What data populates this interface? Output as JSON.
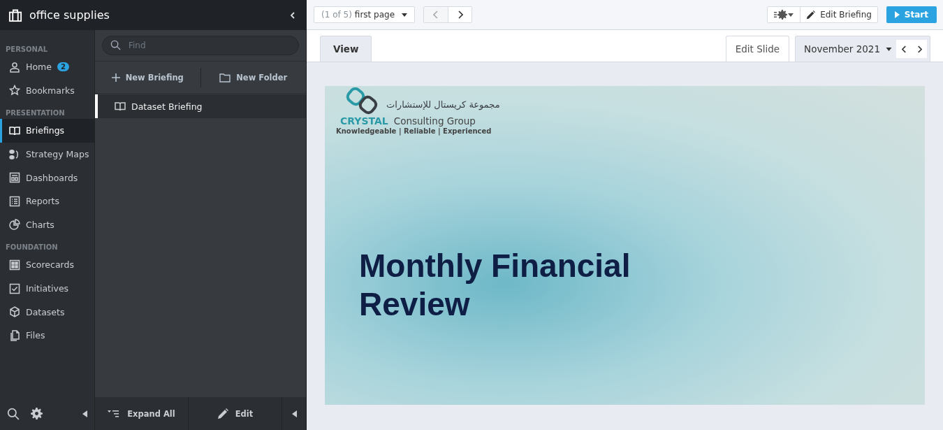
{
  "header": {
    "title": "office supplies"
  },
  "nav": [
    {
      "heading": "PERSONAL",
      "items": [
        {
          "label": "Home",
          "badge": "2",
          "selected": false
        },
        {
          "label": "Bookmarks",
          "selected": false
        }
      ]
    },
    {
      "heading": "PRESENTATION",
      "items": [
        {
          "label": "Briefings",
          "selected": true
        },
        {
          "label": "Strategy Maps",
          "selected": false
        },
        {
          "label": "Dashboards",
          "selected": false
        },
        {
          "label": "Reports",
          "selected": false
        },
        {
          "label": "Charts",
          "selected": false
        }
      ]
    },
    {
      "heading": "FOUNDATION",
      "items": [
        {
          "label": "Scorecards",
          "selected": false
        },
        {
          "label": "Initiatives",
          "selected": false
        },
        {
          "label": "Datasets",
          "selected": false
        },
        {
          "label": "Files",
          "selected": false
        }
      ]
    }
  ],
  "panel": {
    "search": {
      "placeholder": "Find"
    },
    "actions": [
      "New Briefing",
      "New Folder"
    ],
    "items": [
      {
        "label": "Dataset Briefing",
        "selected": true
      }
    ],
    "footer": [
      "Expand All",
      "Edit"
    ]
  },
  "toolbar": {
    "page_count": "(1 of 5)",
    "page_name": "first page",
    "edit_button": "Edit Briefing",
    "start_button": "Start"
  },
  "tabs": [
    {
      "label": "View",
      "selected": true
    },
    {
      "label": "Edit Slide",
      "selected": false
    }
  ],
  "period": "November 2021",
  "slide": {
    "logo_arabic": "مجموعة كريستال للإستشارات",
    "logo_brand": "CRYSTAL",
    "logo_name": "Consulting Group",
    "tagline": "Knowledgeable | Reliable | Experienced",
    "title": "Monthly Financial Review"
  }
}
